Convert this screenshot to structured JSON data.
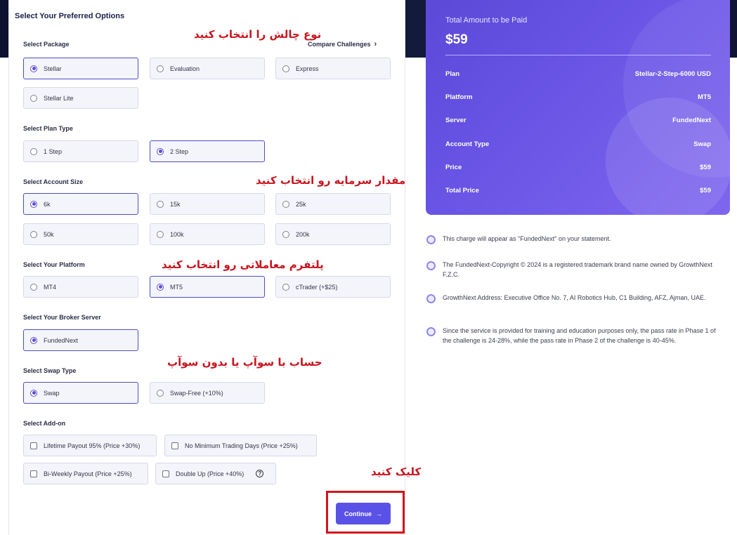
{
  "form": {
    "title": "Select Your Preferred Options",
    "package": {
      "label": "Select Package",
      "compare": "Compare Challenges",
      "options": [
        "Stellar",
        "Evaluation",
        "Express",
        "Stellar Lite"
      ],
      "selected": "Stellar"
    },
    "plan_type": {
      "label": "Select Plan Type",
      "options": [
        "1 Step",
        "2 Step"
      ],
      "selected": "2 Step"
    },
    "account_size": {
      "label": "Select Account Size",
      "options": [
        "6k",
        "15k",
        "25k",
        "50k",
        "100k",
        "200k"
      ],
      "selected": "6k"
    },
    "platform": {
      "label": "Select Your Platform",
      "options": [
        "MT4",
        "MT5",
        "cTrader (+$25)"
      ],
      "selected": "MT5"
    },
    "broker": {
      "label": "Select Your Broker Server",
      "options": [
        "FundedNext"
      ],
      "selected": "FundedNext"
    },
    "swap": {
      "label": "Select Swap Type",
      "options": [
        "Swap",
        "Swap-Free (+10%)"
      ],
      "selected": "Swap"
    },
    "addons": {
      "label": "Select Add-on",
      "options": [
        "Lifetime Payout 95% (Price +30%)",
        "No Minimum Trading Days (Price +25%)",
        "Bi-Weekly Payout (Price +25%)",
        "Double Up (Price +40%)"
      ],
      "help": "?"
    },
    "continue": {
      "label": "Continue",
      "arrow": "→"
    }
  },
  "summary": {
    "header": "Total Amount to be Paid",
    "amount": "$59",
    "rows": [
      {
        "key": "Plan",
        "value": "Stellar-2-Step-6000 USD"
      },
      {
        "key": "Platform",
        "value": "MT5"
      },
      {
        "key": "Server",
        "value": "FundedNext"
      },
      {
        "key": "Account Type",
        "value": "Swap"
      },
      {
        "key": "Price",
        "value": "$59"
      },
      {
        "key": "Total Price",
        "value": "$59"
      }
    ]
  },
  "notes": [
    "This charge will appear as \"FundedNext\" on your statement.",
    "The FundedNext-Copyright © 2024 is a registered trademark brand name owned by GrowthNext F.Z.C.",
    "GrowthNext Address: Executive Office No. 7, AI Robotics Hub, C1 Building, AFZ, Ajman, UAE.",
    "Since the service is provided for training and education purposes only, the pass rate in Phase 1 of the challenge is 24-28%, while the pass rate in Phase 2 of the challenge is 40-45%."
  ],
  "annotations": {
    "challenge": "نوع چالش را انتخاب کنید",
    "capital": "مقدار سرمایه رو انتخاب کنید",
    "platform": "پلتفرم معاملاتی رو انتخاب کنید",
    "swap": "حساب با سوآپ یا بدون سوآپ",
    "click": "کلیک کنید"
  },
  "colors": {
    "accent": "#5a52e6",
    "annotation": "#c8141e",
    "header_band": "#0d1130"
  }
}
